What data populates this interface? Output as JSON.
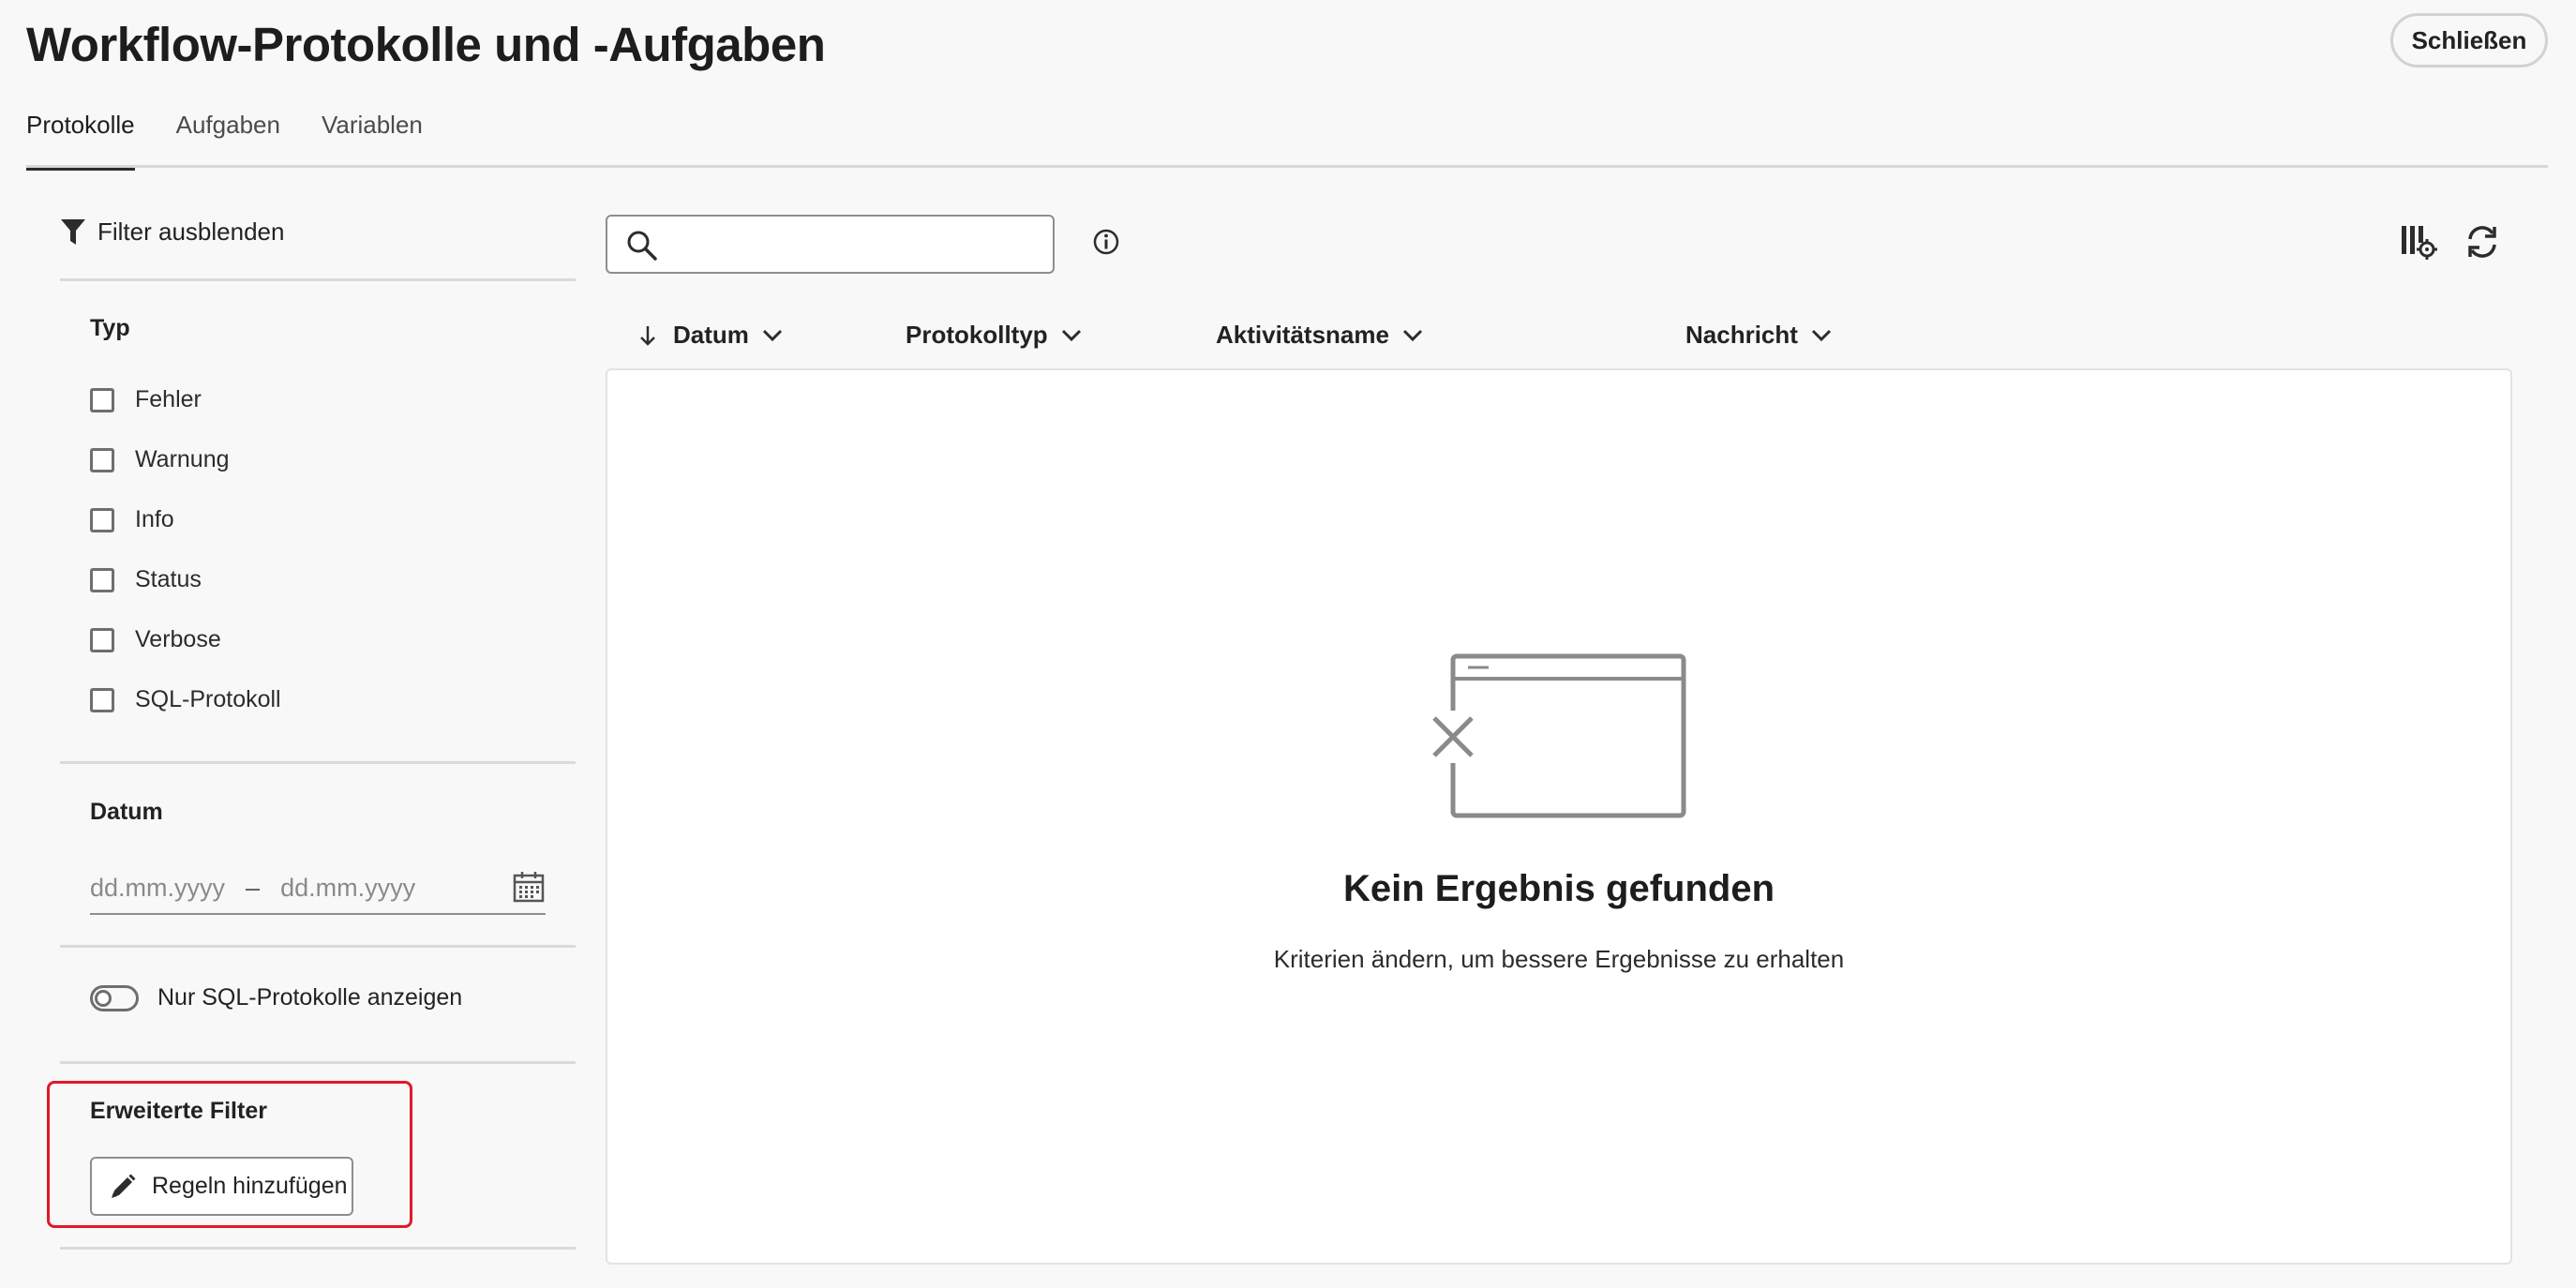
{
  "page": {
    "title": "Workflow-Protokolle und -Aufgaben",
    "close_label": "Schließen"
  },
  "tabs": [
    {
      "label": "Protokolle",
      "active": true
    },
    {
      "label": "Aufgaben",
      "active": false
    },
    {
      "label": "Variablen",
      "active": false
    }
  ],
  "filters": {
    "toggle_label": "Filter ausblenden",
    "type_heading": "Typ",
    "types": [
      {
        "label": "Fehler",
        "checked": false
      },
      {
        "label": "Warnung",
        "checked": false
      },
      {
        "label": "Info",
        "checked": false
      },
      {
        "label": "Status",
        "checked": false
      },
      {
        "label": "Verbose",
        "checked": false
      },
      {
        "label": "SQL-Protokoll",
        "checked": false
      }
    ],
    "date_heading": "Datum",
    "date_from_placeholder": "dd.mm.yyyy",
    "date_separator": "–",
    "date_to_placeholder": "dd.mm.yyyy",
    "sql_only_label": "Nur SQL-Protokolle anzeigen",
    "sql_only_enabled": false,
    "advanced_heading": "Erweiterte Filter",
    "add_rules_label": "Regeln hinzufügen",
    "highlight_color": "#e01a2b"
  },
  "toolbar": {
    "search_placeholder": "",
    "icons": [
      "search-icon",
      "info-icon",
      "column-settings-icon",
      "refresh-icon"
    ]
  },
  "table": {
    "columns": [
      {
        "label": "Datum",
        "sorted": "descending"
      },
      {
        "label": "Protokolltyp"
      },
      {
        "label": "Aktivitätsname"
      },
      {
        "label": "Nachricht"
      }
    ],
    "rows": []
  },
  "empty_state": {
    "title": "Kein Ergebnis gefunden",
    "subtitle": "Kriterien ändern, um bessere Ergebnisse zu erhalten"
  }
}
